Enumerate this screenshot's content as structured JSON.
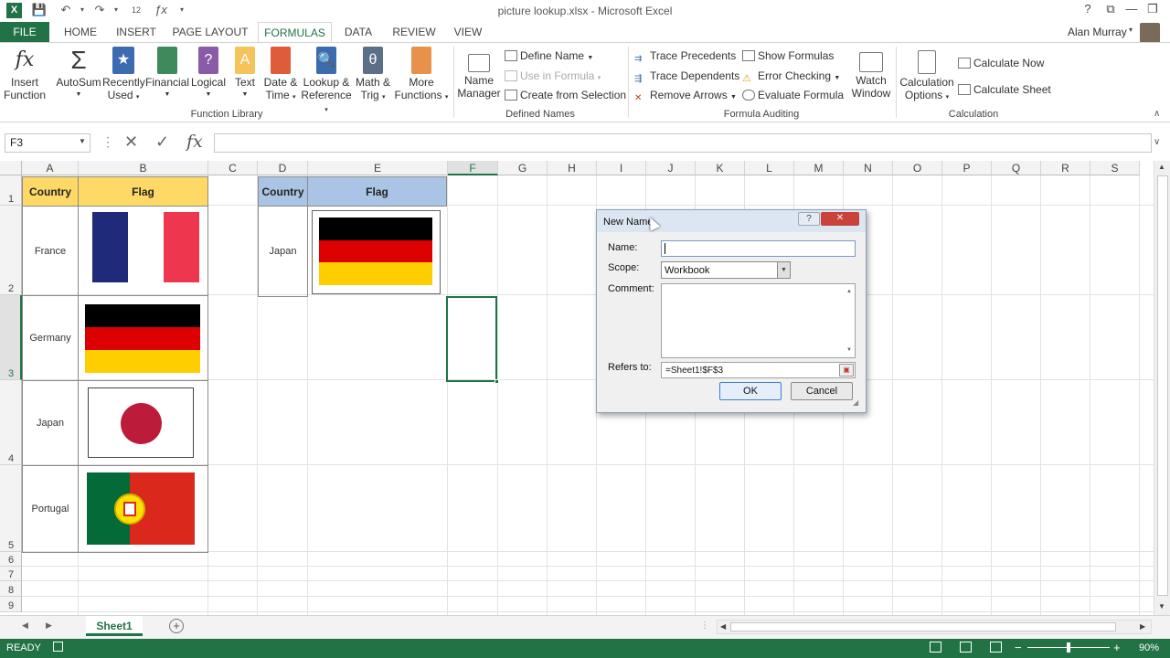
{
  "window": {
    "title": "picture lookup.xlsx - Microsoft Excel",
    "user": "Alan Murray"
  },
  "quick_access": {
    "font_size": "12"
  },
  "tabs": [
    "FILE",
    "HOME",
    "INSERT",
    "PAGE LAYOUT",
    "FORMULAS",
    "DATA",
    "REVIEW",
    "VIEW"
  ],
  "ribbon": {
    "insert_function": [
      "Insert",
      "Function"
    ],
    "autosum": "AutoSum",
    "recently_used": [
      "Recently",
      "Used"
    ],
    "financial": "Financial",
    "logical": "Logical",
    "text": "Text",
    "date_time": [
      "Date &",
      "Time"
    ],
    "lookup": [
      "Lookup &",
      "Reference"
    ],
    "math": [
      "Math &",
      "Trig"
    ],
    "more": [
      "More",
      "Functions"
    ],
    "function_library": "Function Library",
    "name_manager": [
      "Name",
      "Manager"
    ],
    "define_name": "Define Name",
    "use_in_formula": "Use in Formula",
    "create_from_selection": "Create from Selection",
    "defined_names": "Defined Names",
    "trace_precedents": "Trace Precedents",
    "trace_dependents": "Trace Dependents",
    "remove_arrows": "Remove Arrows",
    "show_formulas": "Show Formulas",
    "error_checking": "Error Checking",
    "evaluate_formula": "Evaluate Formula",
    "watch_window": [
      "Watch",
      "Window"
    ],
    "formula_auditing": "Formula Auditing",
    "calc_options": [
      "Calculation",
      "Options"
    ],
    "calc_now": "Calculate Now",
    "calc_sheet": "Calculate Sheet",
    "calculation": "Calculation"
  },
  "formula_bar": {
    "name_box": "F3",
    "fx": "fx",
    "value": ""
  },
  "columns": [
    "A",
    "B",
    "C",
    "D",
    "E",
    "F",
    "G",
    "H",
    "I",
    "J",
    "K",
    "L",
    "M",
    "N",
    "O",
    "P",
    "Q",
    "R",
    "S"
  ],
  "rows": [
    "1",
    "2",
    "3",
    "4",
    "5",
    "6",
    "7",
    "8",
    "9"
  ],
  "table1": {
    "header_country": "Country",
    "header_flag": "Flag",
    "countries": [
      "France",
      "Germany",
      "Japan",
      "Portugal"
    ]
  },
  "table2": {
    "header_country": "Country",
    "header_flag": "Flag",
    "country": "Japan"
  },
  "sheet": {
    "name": "Sheet1"
  },
  "status": {
    "mode": "READY",
    "zoom": "90%"
  },
  "dialog": {
    "title": "New Name",
    "name_label": "Name:",
    "name_value": "",
    "scope_label": "Scope:",
    "scope_value": "Workbook",
    "comment_label": "Comment:",
    "refers_label": "Refers to:",
    "refers_value": "=Sheet1!$F$3",
    "ok": "OK",
    "cancel": "Cancel",
    "help": "?"
  },
  "colors": {
    "excel_green": "#217346",
    "header_yellow": "#ffd966",
    "header_blue": "#a9c4e4"
  }
}
